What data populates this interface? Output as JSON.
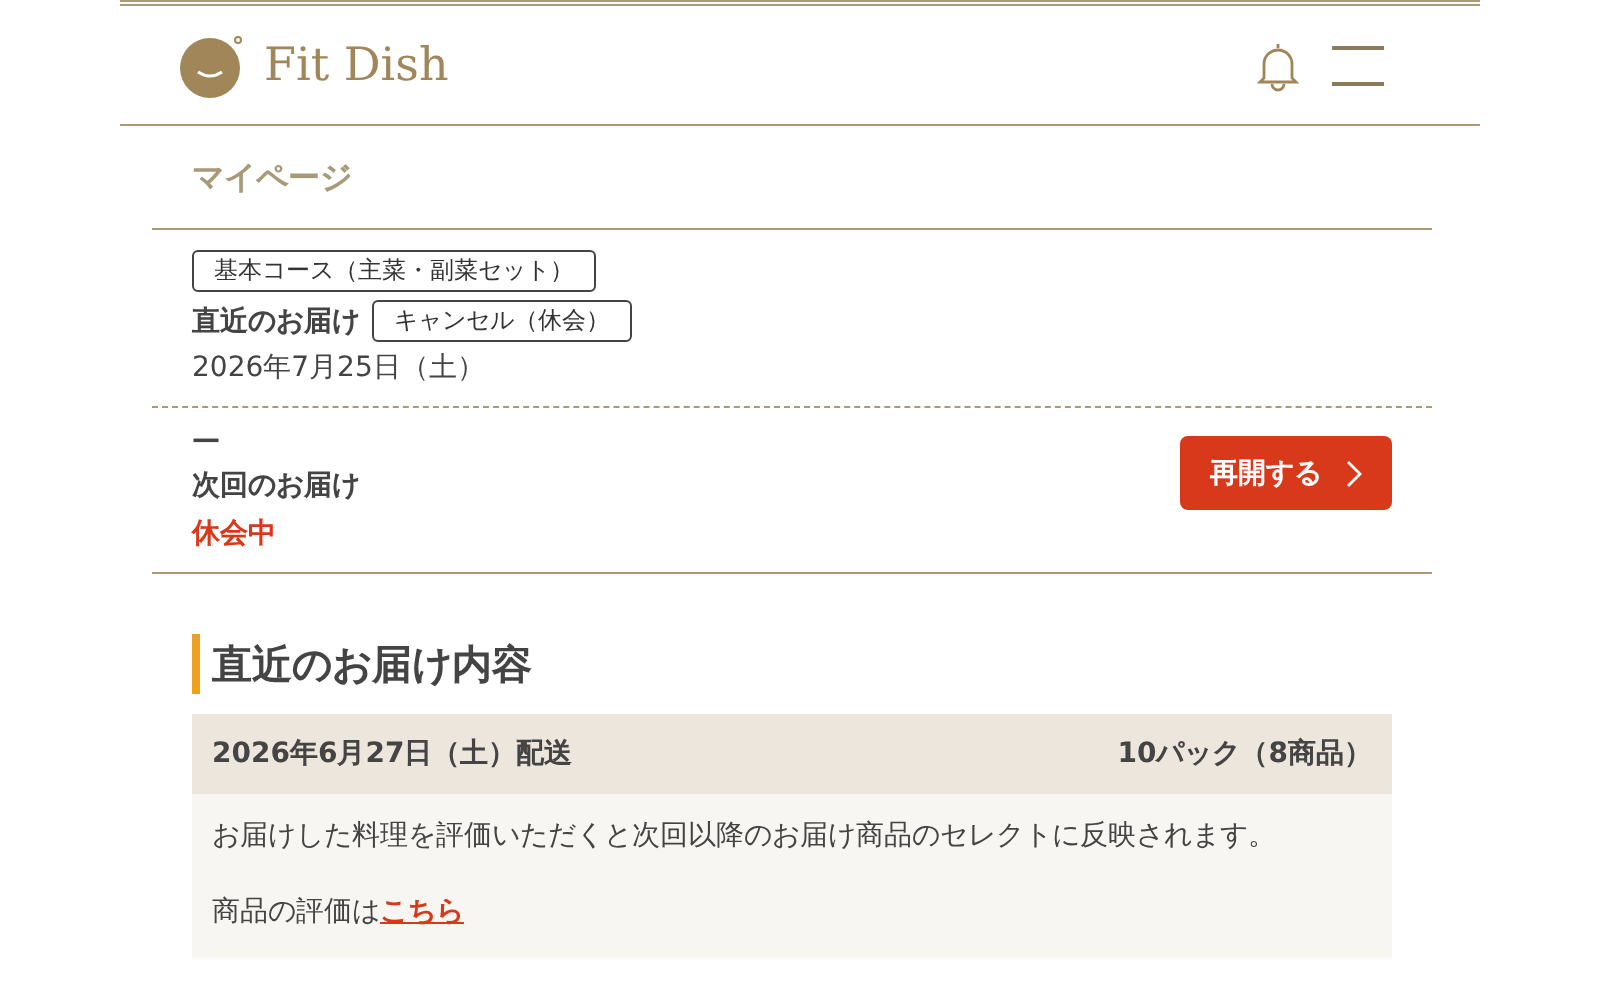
{
  "header": {
    "logo": "Fit Dish"
  },
  "breadcrumb": "マイページ",
  "latest": {
    "course_tag": "基本コース（主菜・副菜セット）",
    "label": "直近のお届け",
    "status_tag": "キャンセル（休会）",
    "date": "2026年7月25日（土）"
  },
  "next": {
    "date": "—",
    "label": "次回のお届け",
    "status": "休会中",
    "button": "再開する"
  },
  "contents": {
    "heading": "直近のお届け内容",
    "date": "2026年6月27日（土）配送",
    "count": "10パック（8商品）",
    "note": "お届けした料理を評価いただくと次回以降のお届け商品のセレクトに反映されます。",
    "rating_text": "商品の評価は",
    "rating_link": "こちら"
  }
}
